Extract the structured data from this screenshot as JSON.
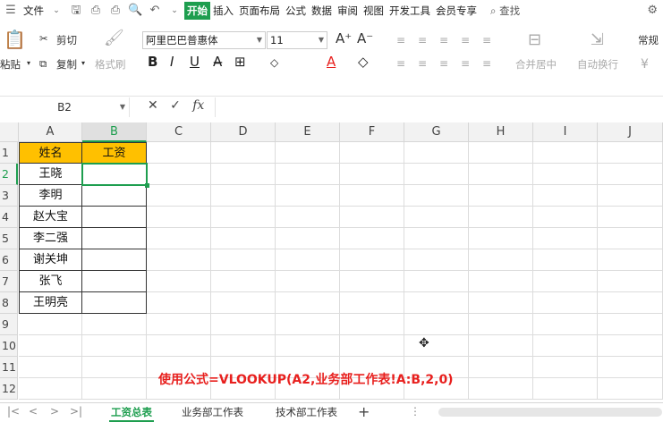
{
  "menubar": {
    "file": "文件",
    "tabs": [
      "开始",
      "插入",
      "页面布局",
      "公式",
      "数据",
      "审阅",
      "视图",
      "开发工具",
      "会员专享"
    ],
    "search": "查找"
  },
  "ribbon": {
    "paste": "粘贴",
    "cut": "剪切",
    "copy": "复制",
    "format_painter": "格式刷",
    "font_name": "阿里巴巴普惠体",
    "font_size": "11",
    "merge_center": "合并居中",
    "wrap_text": "自动换行",
    "number_format": "常规"
  },
  "formula_bar": {
    "name_box": "B2",
    "fx": "fx",
    "value": ""
  },
  "columns": [
    "A",
    "B",
    "C",
    "D",
    "E",
    "F",
    "G",
    "H",
    "I",
    "J"
  ],
  "rows": [
    "1",
    "2",
    "3",
    "4",
    "5",
    "6",
    "7",
    "8",
    "9",
    "10",
    "11",
    "12"
  ],
  "table": {
    "header": [
      "姓名",
      "工资"
    ],
    "names": [
      "王晓",
      "李明",
      "赵大宝",
      "李二强",
      "谢关坤",
      "张飞",
      "王明亮"
    ]
  },
  "annotation": "使用公式=VLOOKUP(A2,业务部工作表!A:B,2,0)",
  "sheet_tabs": [
    "工资总表",
    "业务部工作表",
    "技术部工作表"
  ],
  "colors": {
    "accent": "#1e9e4f",
    "header_fill": "#ffc000",
    "annotation": "#e8201e"
  }
}
